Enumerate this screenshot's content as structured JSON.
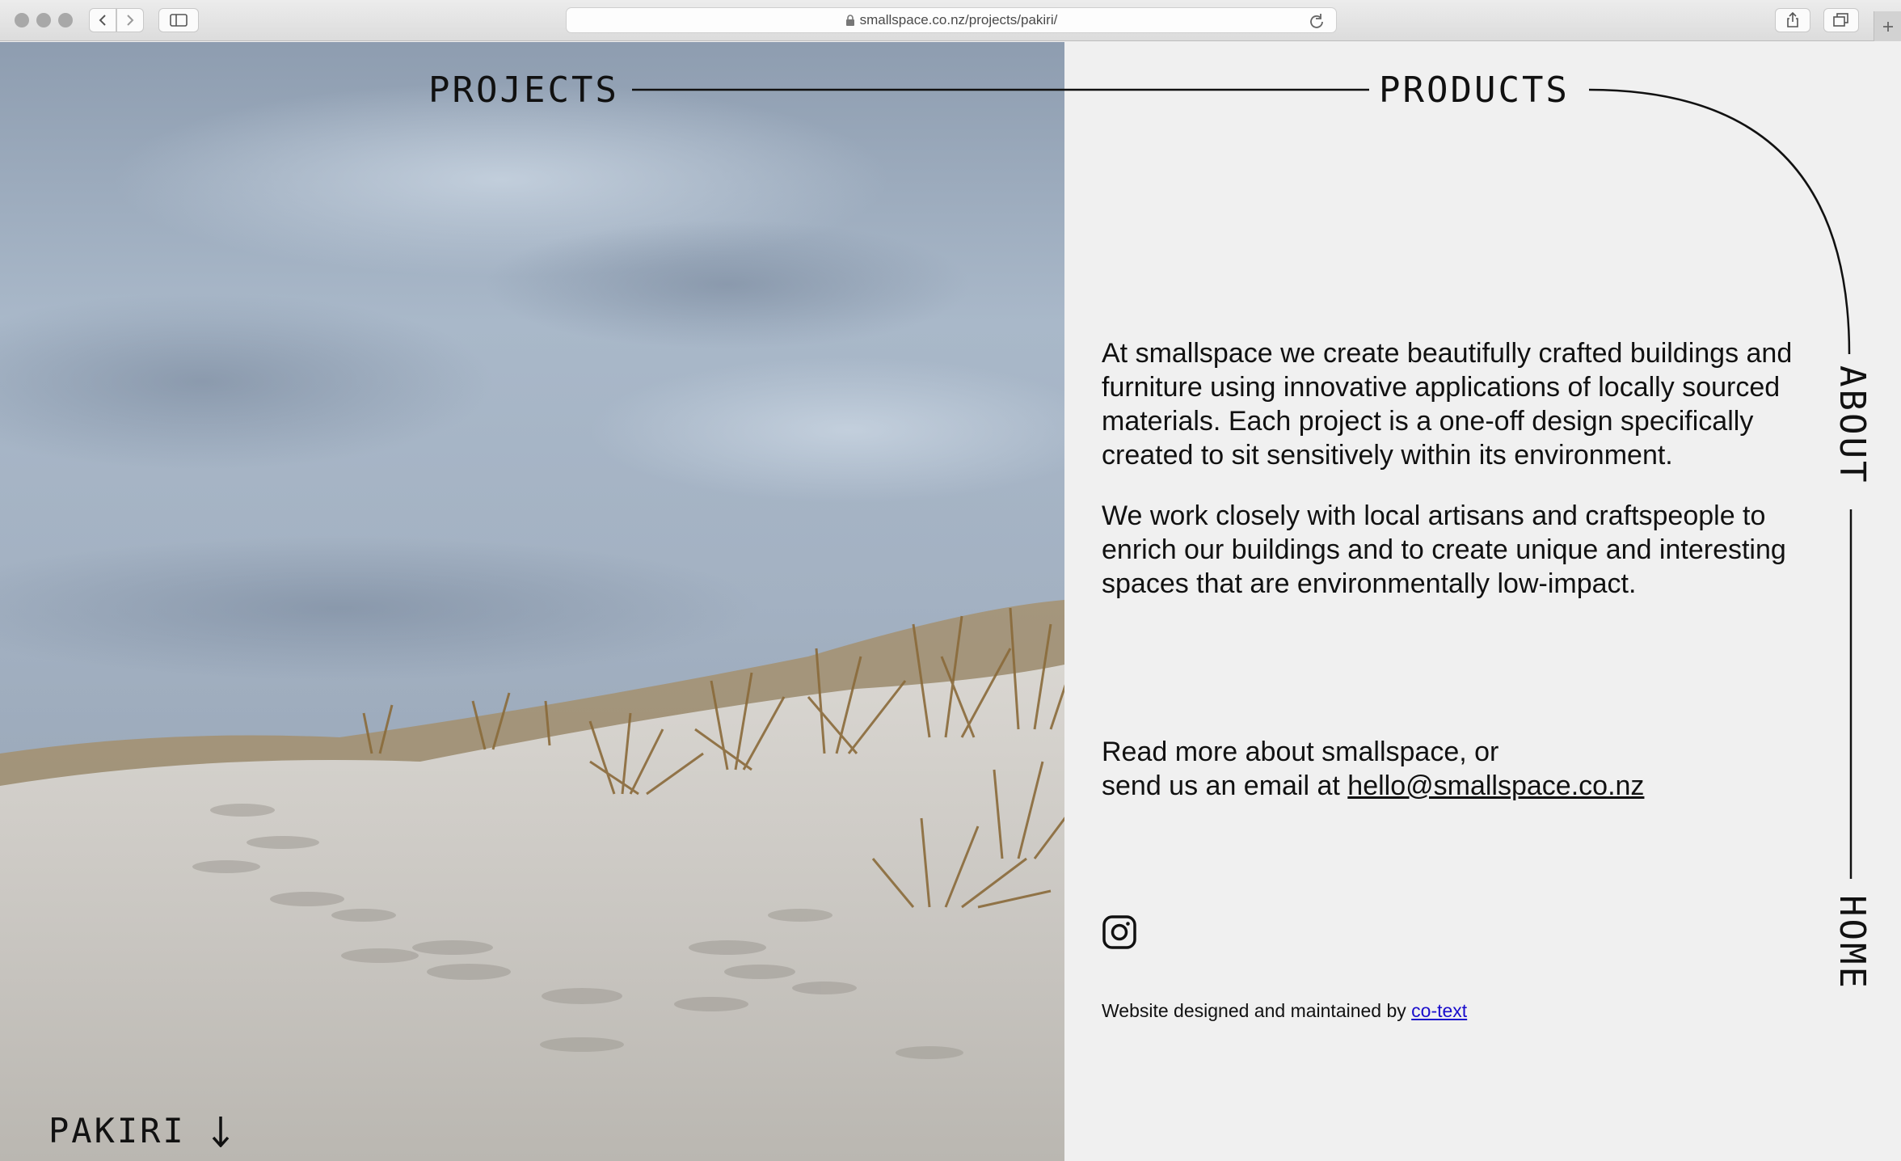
{
  "browser": {
    "url": "smallspace.co.nz/projects/pakiri/"
  },
  "nav": {
    "projects": "PROJECTS",
    "products": "PRODUCTS",
    "about": "ABOUT",
    "home": "HOME"
  },
  "about": {
    "paragraph1": "At smallspace we create beautifully crafted buildings and furniture using innovative applications of locally sourced materials. Each project is a one-off design specifically created to sit sensitively within its environment.",
    "paragraph2": "We work closely with local artisans and craftspeople to enrich our buildings and to create unique and interesting spaces that are environmentally low-impact."
  },
  "contact": {
    "line1": "Read more about smallspace, or",
    "line2_prefix": "send us an email at ",
    "email": "hello@smallspace.co.nz"
  },
  "social": {
    "icon": "instagram-icon"
  },
  "credit": {
    "prefix": "Website designed and maintained by ",
    "link": "co-text",
    "link_color": "#1a0dcc"
  },
  "project": {
    "name": "PAKIRI"
  }
}
